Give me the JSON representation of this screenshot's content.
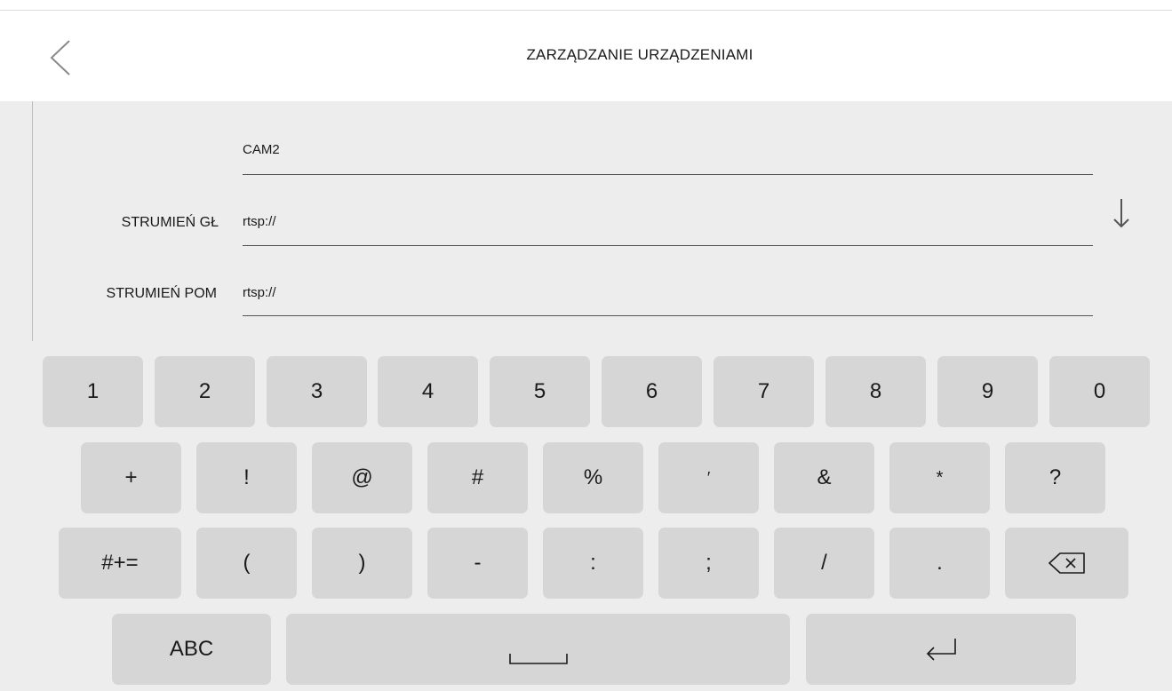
{
  "header": {
    "title": "ZARZĄDZANIE URZĄDZENIAMI",
    "back_icon": "chevron-left-icon"
  },
  "form": {
    "name_value": "CAM2",
    "main_stream_label": "STRUMIEŃ GŁ",
    "main_stream_value": "rtsp://",
    "sub_stream_label": "STRUMIEŃ POM",
    "sub_stream_value": "rtsp://",
    "scroll_icon": "arrow-down-icon"
  },
  "keyboard": {
    "row1": [
      "1",
      "2",
      "3",
      "4",
      "5",
      "6",
      "7",
      "8",
      "9",
      "0"
    ],
    "row2": [
      "+",
      "!",
      "@",
      "#",
      "%",
      "′",
      "&",
      "*",
      "?"
    ],
    "row3": [
      "#+=",
      "(",
      ")",
      "-",
      ":",
      ";",
      "/",
      "."
    ],
    "backspace_icon": "backspace-icon",
    "abc_label": "ABC",
    "space_icon": "space-icon",
    "enter_icon": "enter-icon"
  }
}
